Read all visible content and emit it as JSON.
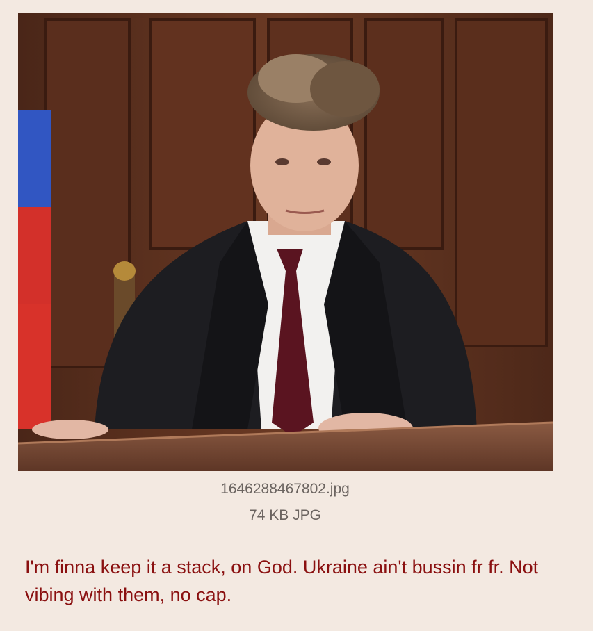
{
  "post": {
    "image": {
      "description_icon": "posted-photo",
      "file_name": "1646288467802.jpg",
      "file_meta": "74 KB JPG"
    },
    "message": "I'm finna keep it a stack, on God. Ukraine ain't bussin fr fr. Not vibing with them, no cap."
  },
  "colors": {
    "background": "#f3e9e1",
    "message_text": "#8a1010",
    "meta_text": "#6b6460"
  }
}
